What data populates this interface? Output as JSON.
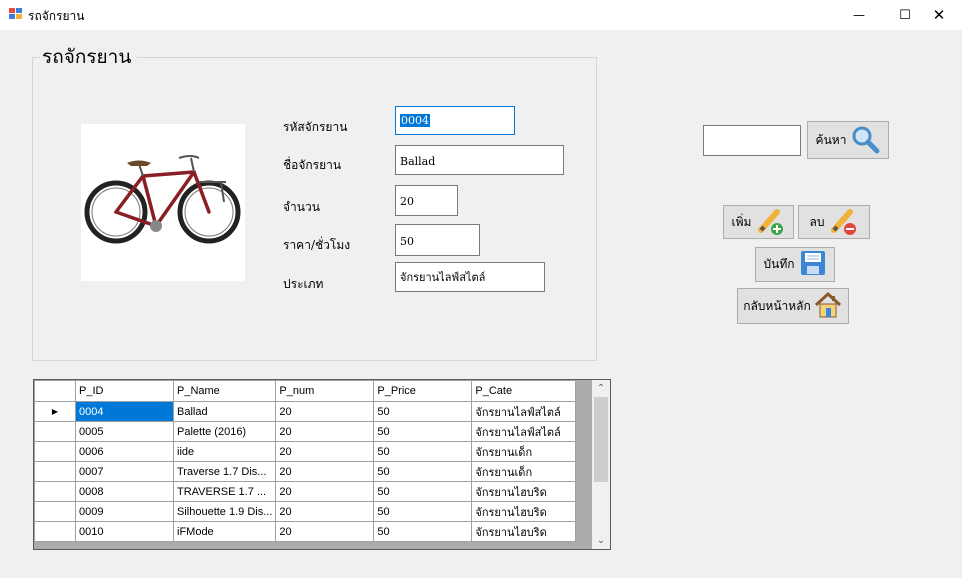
{
  "window": {
    "title": "รถจักรยาน",
    "minimize_glyph": "—",
    "maximize_glyph": "☐",
    "close_glyph": "✕"
  },
  "group": {
    "title": "รถจักรยาน"
  },
  "form": {
    "id_label": "รหัสจักรยาน",
    "id_value": "0004",
    "name_label": "ชื่อจักรยาน",
    "name_value": "Ballad",
    "qty_label": "จำนวน",
    "qty_value": "20",
    "price_label": "ราคา/ชั่วโมง",
    "price_value": "50",
    "type_label": "ประเภท",
    "type_value": "จักรยานไลฟ์สไตล์"
  },
  "search": {
    "value": "",
    "button_label": "ค้นหา"
  },
  "actions": {
    "add_label": "เพิ่ม",
    "delete_label": "ลบ",
    "save_label": "บันทึก",
    "home_label": "กลับหน้าหลัก"
  },
  "table": {
    "columns": [
      "P_ID",
      "P_Name",
      "P_num",
      "P_Price",
      "P_Cate"
    ],
    "rows": [
      [
        "0004",
        "Ballad",
        "20",
        "50",
        "จักรยานไลฟ์สไตล์"
      ],
      [
        "0005",
        "Palette (2016)",
        "20",
        "50",
        "จักรยานไลฟ์สไตล์"
      ],
      [
        "0006",
        "iide",
        "20",
        "50",
        "จักรยานเด็ก"
      ],
      [
        "0007",
        "Traverse 1.7 Dis...",
        "20",
        "50",
        "จักรยานเด็ก"
      ],
      [
        "0008",
        "TRAVERSE 1.7 ...",
        "20",
        "50",
        "จักรยานไฮบริด"
      ],
      [
        "0009",
        "Silhouette 1.9 Dis...",
        "20",
        "50",
        "จักรยานไฮบริด"
      ],
      [
        "0010",
        "iFMode",
        "20",
        "50",
        "จักรยานไฮบริด"
      ]
    ],
    "current_row_marker": "▶",
    "scroll_up": "⌃",
    "scroll_down": "⌄"
  },
  "colors": {
    "selection": "#0078d7",
    "background": "#f0f0f0",
    "bike_frame": "#8b1e24"
  }
}
